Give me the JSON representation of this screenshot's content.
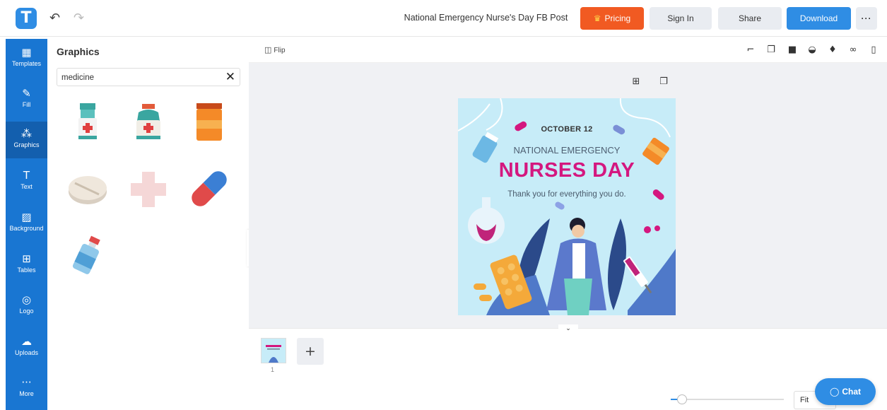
{
  "app": {
    "logo_letter": "T",
    "undo_glyph": "↶",
    "redo_glyph": "↷"
  },
  "header": {
    "doc_title": "National Emergency Nurse's Day FB Post",
    "pricing_label": "Pricing",
    "signin_label": "Sign In",
    "share_label": "Share",
    "download_label": "Download",
    "more_label": "···"
  },
  "sidebar": {
    "items": [
      {
        "label": "Templates",
        "icon": "▦"
      },
      {
        "label": "Fill",
        "icon": "✎"
      },
      {
        "label": "Graphics",
        "icon": "⁂"
      },
      {
        "label": "Text",
        "icon": "T"
      },
      {
        "label": "Background",
        "icon": "▨"
      },
      {
        "label": "Tables",
        "icon": "⊞"
      },
      {
        "label": "Logo",
        "icon": "◎"
      },
      {
        "label": "Uploads",
        "icon": "☁"
      },
      {
        "label": "More",
        "icon": "···"
      }
    ]
  },
  "panel": {
    "title": "Graphics",
    "search_value": "medicine",
    "clear_glyph": "✕"
  },
  "toolbar": {
    "flip_label": "Flip"
  },
  "design": {
    "date": "OCTOBER 12",
    "subtitle": "NATIONAL EMERGENCY",
    "title": "NURSES DAY",
    "thanks": "Thank you for everything you do."
  },
  "pages": {
    "current": "1",
    "add_glyph": "+"
  },
  "zoom": {
    "fit_label": "Fit",
    "level": 0.1
  },
  "chat": {
    "label": "Chat"
  },
  "colors": {
    "accent": "#2f8de4",
    "pricing": "#f15a22",
    "sidebar": "#1976d2",
    "title_pink": "#d4177f"
  }
}
